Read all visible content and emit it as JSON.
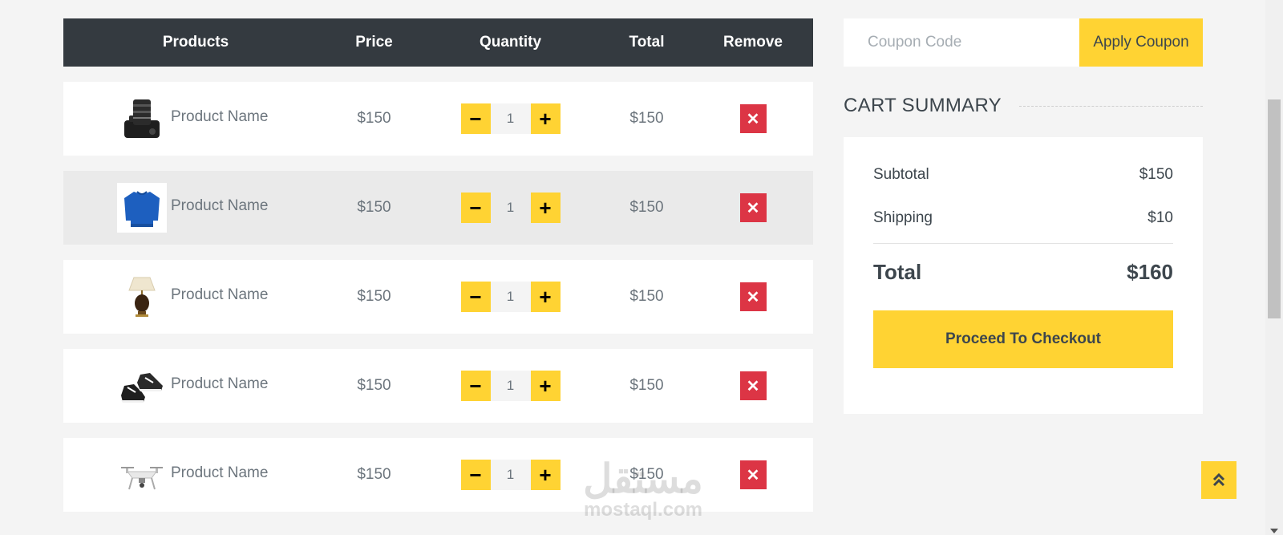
{
  "table": {
    "headers": {
      "products": "Products",
      "price": "Price",
      "quantity": "Quantity",
      "total": "Total",
      "remove": "Remove"
    },
    "rows": [
      {
        "image": "camera-image",
        "name": "Product Name",
        "price": "$150",
        "quantity": "1",
        "total": "$150"
      },
      {
        "image": "sweater-image",
        "name": "Product Name",
        "price": "$150",
        "quantity": "1",
        "total": "$150"
      },
      {
        "image": "lamp-image",
        "name": "Product Name",
        "price": "$150",
        "quantity": "1",
        "total": "$150"
      },
      {
        "image": "shoes-image",
        "name": "Product Name",
        "price": "$150",
        "quantity": "1",
        "total": "$150"
      },
      {
        "image": "drone-image",
        "name": "Product Name",
        "price": "$150",
        "quantity": "1",
        "total": "$150"
      }
    ],
    "minus_icon": "−",
    "plus_icon": "+",
    "remove_icon": "✕"
  },
  "coupon": {
    "placeholder": "Coupon Code",
    "button_label": "Apply Coupon"
  },
  "summary": {
    "title": "CART SUMMARY",
    "subtotal_label": "Subtotal",
    "subtotal_value": "$150",
    "shipping_label": "Shipping",
    "shipping_value": "$10",
    "total_label": "Total",
    "total_value": "$160",
    "checkout_label": "Proceed To Checkout"
  },
  "watermark": {
    "arabic": "مستقل",
    "latin": "mostaql.com"
  },
  "colors": {
    "accent": "#ffd333",
    "header_bg": "#343a40",
    "danger": "#dc3545",
    "page_bg": "#f4f4f4"
  }
}
